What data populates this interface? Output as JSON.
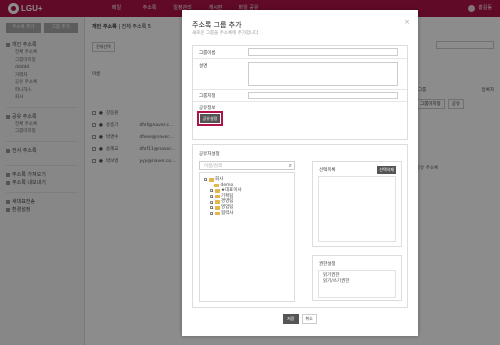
{
  "app": {
    "logo_text": "LGU+",
    "nav": [
      "메일",
      "주소록",
      "일정관리",
      "게시판",
      "파일 공유"
    ],
    "user_name": "홍길동"
  },
  "sidebar": {
    "btn_add": "주소록 추가",
    "btn_group": "그룹 추가",
    "personal_head": "개인 주소록",
    "personal_items": [
      "전체 주소록",
      "그룹미지정",
      "ddddd",
      "거래처",
      "공유 주소록",
      "파니하스",
      "회사"
    ],
    "shared_head": "공유 주소록",
    "shared_items": [
      "전체 주소록",
      "그룹미지정"
    ],
    "company_head": "전사 주소록",
    "bottom_items": [
      "주소록 가져오기",
      "주소록 내보내기",
      "새대표전송",
      "환경설정"
    ]
  },
  "content": {
    "breadcrumb_main": "개인 주소록",
    "breadcrumb_sub": "전체 주소록 5",
    "toolbar": [
      "전체선택",
      "메일",
      "삭제",
      "그룹",
      "이동",
      "복사"
    ],
    "col_name": "이름",
    "col_group": "그룹",
    "col_date": "등록자",
    "rows": [
      {
        "name": "강동원",
        "email": ""
      },
      {
        "name": "송중기",
        "email": "dfxf@naver.c..."
      },
      {
        "name": "박명수",
        "email": "dfxee@naver..."
      },
      {
        "name": "송혜교",
        "email": "dfxf11@naver..."
      },
      {
        "name": "박보영",
        "email": "yyy@naver.co..."
      }
    ],
    "group_select": "그룹미지정",
    "group_btn": "공유",
    "row_group": "공유 주소록"
  },
  "modal": {
    "title": "주소록 그룹 추가",
    "desc": "새로운 그룹을 주소록에 추가합니다.",
    "label_group_name": "그룹이름",
    "label_description": "설명",
    "label_group_assign": "그룹지정",
    "label_share": "공유정보",
    "share_button": "공유설정",
    "share_panel_title": "공유자설정",
    "search_placeholder": "이름/검색",
    "tree": {
      "root": "회사",
      "items": [
        "demo",
        "★대표이사",
        "기획팀",
        "경영팀",
        "영업팀",
        "협력사"
      ]
    },
    "selected_title": "선택목록",
    "selected_delete": "선택삭제",
    "permission_title": "권한설정",
    "permissions": [
      "읽기권한",
      "읽기/쓰기권한"
    ],
    "save": "저장",
    "cancel": "취소"
  }
}
